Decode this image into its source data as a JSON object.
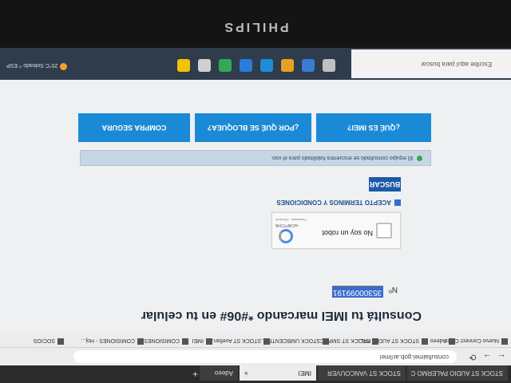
{
  "brand": "PHILIPS",
  "browser": {
    "tabs": [
      {
        "label": "STOCK ST AUDIO PALERMO C"
      },
      {
        "label": "STOCK ST VANCOUVER"
      },
      {
        "label": "IMEI"
      },
      {
        "label": "Adeeo"
      }
    ],
    "url": "consultaimei.gob.ar/imei",
    "bookmarks": [
      "Nuevo Connect Client",
      "Adeeo",
      "STOCK ST AUDIO PAL...",
      "STOCK ST SMPOC...",
      "STOCK UMBCENTRE...",
      "STOCK ST Avellan...",
      "IMEI",
      "COMISIONES",
      "COMISIONES - Hoj...",
      "SOCIOS"
    ]
  },
  "page": {
    "title": "Consultá tu IMEI marcando *#06# en tu celular",
    "imei_label": "Nº",
    "imei_value": "35300099191",
    "captcha_text": "No soy un robot",
    "captcha_brand": "reCAPTCHA",
    "captcha_links": "Privacidad - Términos",
    "terms_label": "ACEPTO TERMINOS Y CONDICIONES",
    "search_button": "BUSCAR",
    "status_message": "El equipo consultado se encuentra habilitado para el uso.",
    "cta": {
      "what_is": "¿QUÉ ES IMEI?",
      "why_block": "¿POR QUÉ SE BLOQUEA?",
      "safe_buy": "COMPRA SEGURA"
    }
  },
  "taskbar": {
    "search_placeholder": "Escribe aquí para buscar",
    "weather": "25°C Soleado",
    "lang": "ESP"
  }
}
